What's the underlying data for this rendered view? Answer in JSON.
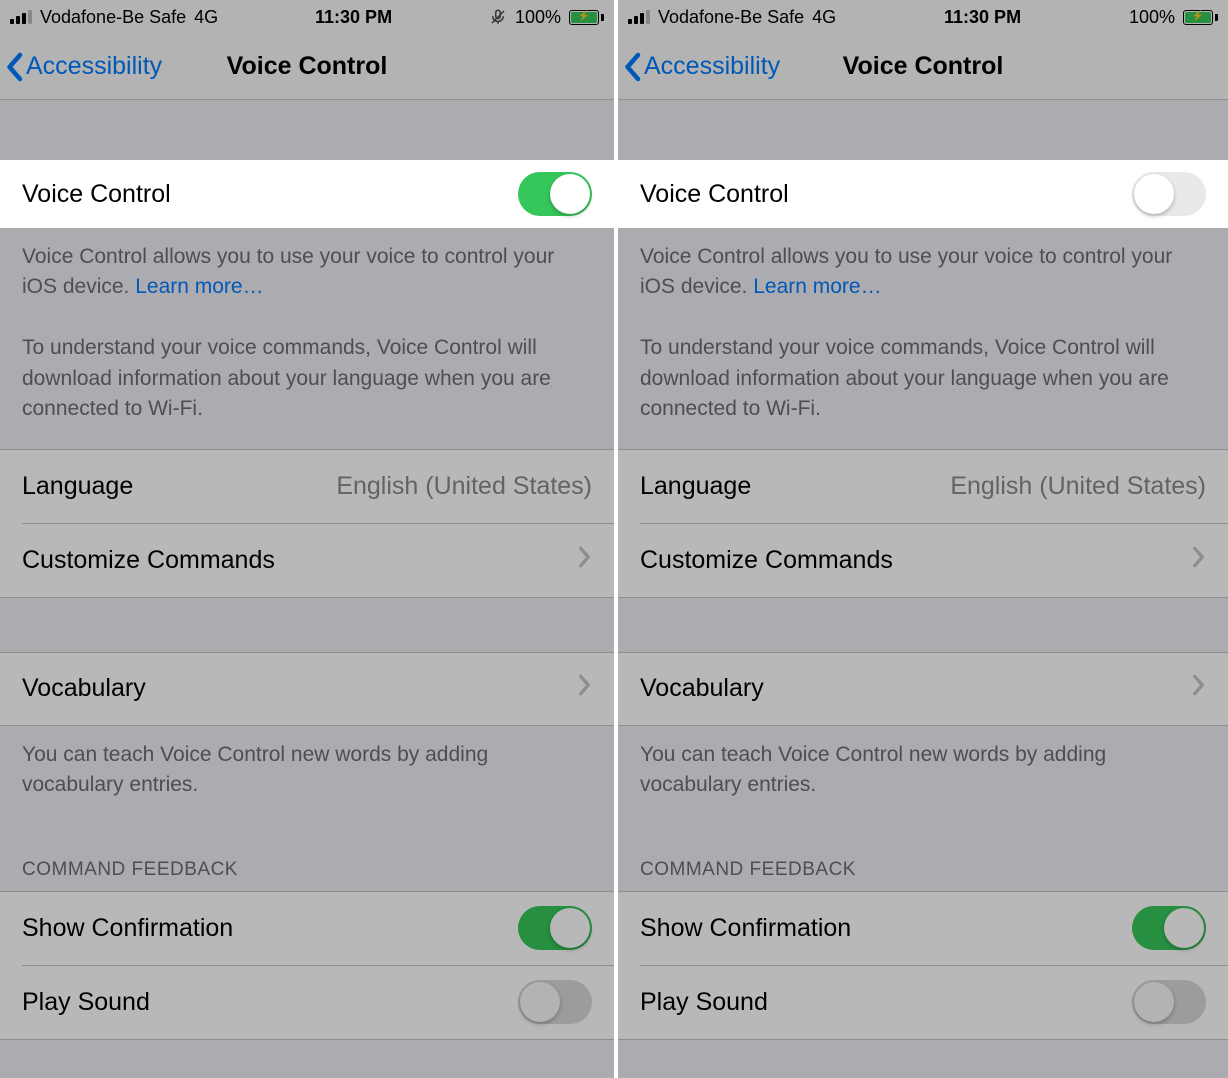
{
  "statusbar": {
    "carrier": "Vodafone-Be Safe",
    "network": "4G",
    "time": "11:30 PM",
    "battery_pct": "100%"
  },
  "nav": {
    "back_label": "Accessibility",
    "title": "Voice Control"
  },
  "voice_control": {
    "row_label": "Voice Control",
    "description_1": "Voice Control allows you to use your voice to control your iOS device. ",
    "learn_more": "Learn more…",
    "description_2": "To understand your voice commands, Voice Control will download information about your language when you are connected to Wi-Fi."
  },
  "language": {
    "label": "Language",
    "value": "English (United States)"
  },
  "customize": {
    "label": "Customize Commands"
  },
  "vocabulary": {
    "label": "Vocabulary",
    "footer": "You can teach Voice Control new words by adding vocabulary entries."
  },
  "feedback": {
    "header": "COMMAND FEEDBACK",
    "show_confirmation": "Show Confirmation",
    "play_sound": "Play Sound"
  },
  "left_panel": {
    "voice_control_on": true,
    "show_mic_icon": true
  },
  "right_panel": {
    "voice_control_on": false,
    "show_mic_icon": false
  }
}
